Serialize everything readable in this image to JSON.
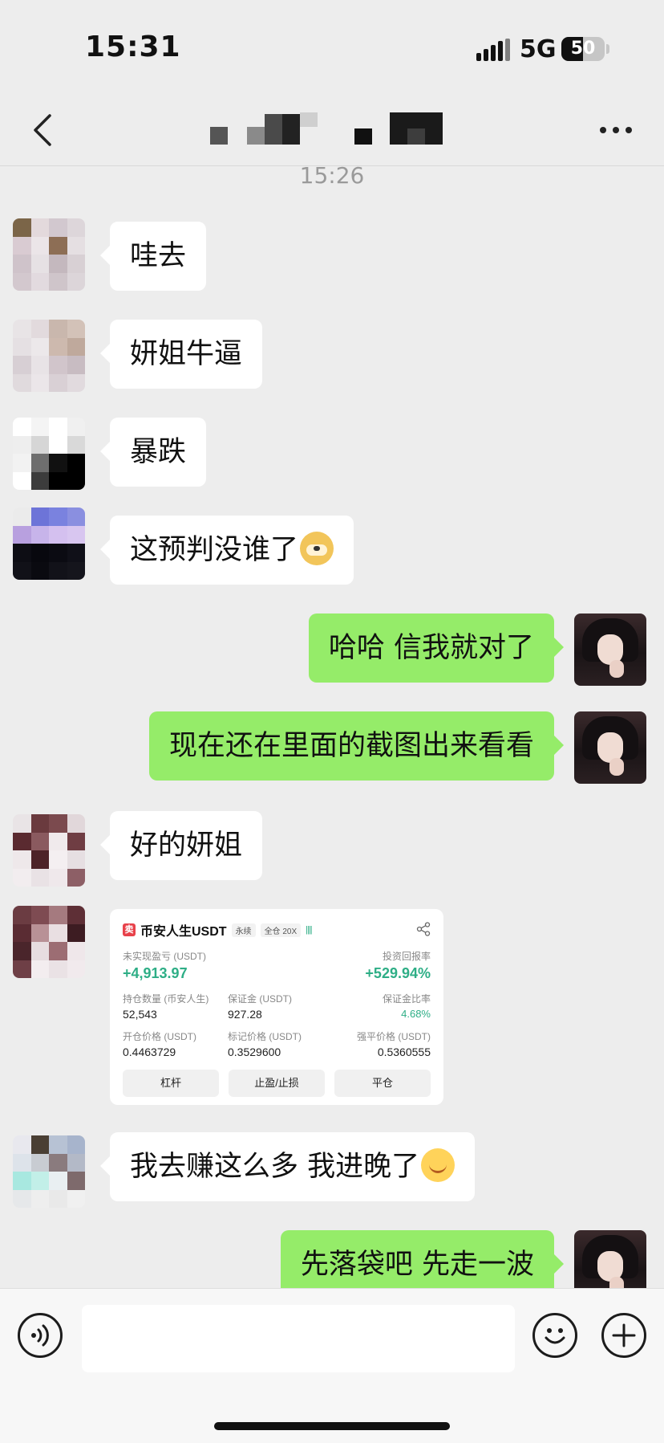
{
  "status_bar": {
    "time": "15:31",
    "network": "5G",
    "battery": "50"
  },
  "header": {
    "contact_name_obscured": true
  },
  "timestamp": "15:26",
  "messages": [
    {
      "side": "in",
      "text": "哇去"
    },
    {
      "side": "in",
      "text": "妍姐牛逼"
    },
    {
      "side": "in",
      "text": "暴跌"
    },
    {
      "side": "in",
      "text": "这预判没谁了",
      "emoji": "doge-emoji"
    },
    {
      "side": "out",
      "text": "哈哈 信我就对了"
    },
    {
      "side": "out",
      "text": "现在还在里面的截图出来看看"
    },
    {
      "side": "in",
      "text": "好的妍姐"
    },
    {
      "side": "in",
      "type": "image",
      "text": ""
    },
    {
      "side": "in",
      "text": "我去赚这么多 我进晚了",
      "emoji": "smile-emoji"
    },
    {
      "side": "out",
      "text": "先落袋吧 先走一波"
    }
  ],
  "trade_card": {
    "logo": "卖",
    "symbol": "币安人生USDT",
    "tag_perpetual": "永续",
    "tag_margin": "全仓 20X",
    "bars": "||||",
    "unrealized_pnl_label": "未实现盈亏 (USDT)",
    "unrealized_pnl": "+4,913.97",
    "roi_label": "投资回报率",
    "roi": "+529.94%",
    "position_size_label": "持仓数量 (币安人生)",
    "position_size": "52,543",
    "margin_label": "保证金 (USDT)",
    "margin": "927.28",
    "margin_ratio_label": "保证金比率",
    "margin_ratio": "4.68%",
    "entry_price_label": "开仓价格 (USDT)",
    "entry_price": "0.4463729",
    "mark_price_label": "标记价格 (USDT)",
    "mark_price": "0.3529600",
    "liq_price_label": "强平价格 (USDT)",
    "liq_price": "0.5360555",
    "btn_leverage": "杠杆",
    "btn_tpsl": "止盈/止损",
    "btn_close": "平仓"
  },
  "input": {
    "placeholder": ""
  },
  "colors": {
    "out_bubble": "#95ec69",
    "in_bubble": "#ffffff",
    "background": "#ededed",
    "profit_green": "#2eae86"
  }
}
